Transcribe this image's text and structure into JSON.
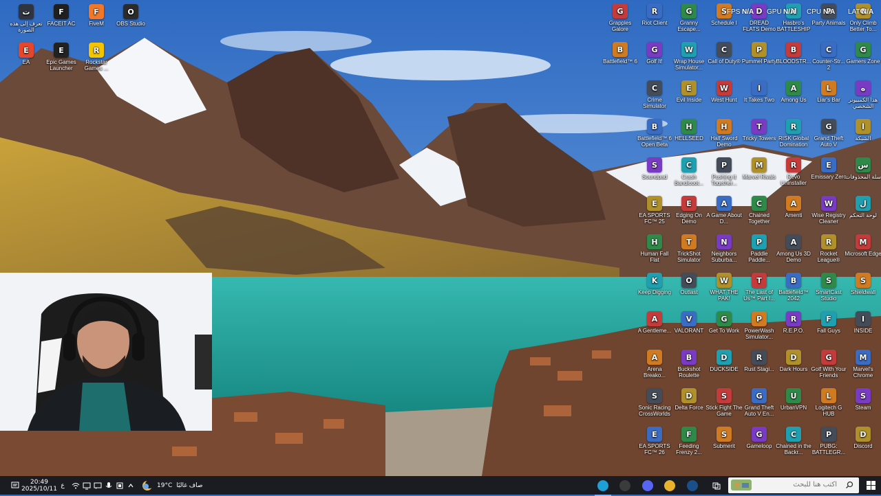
{
  "desktop": {
    "icons_left": [
      {
        "label": "تعرف إلى هذه الصورة",
        "icon": "info-icon",
        "color": "#2f3440"
      },
      {
        "label": "FACEIT AC",
        "icon": "faceit-icon",
        "color": "#1f1f1f"
      },
      {
        "label": "FiveM",
        "icon": "fivem-icon",
        "color": "#f0782a"
      },
      {
        "label": "OBS Studio",
        "icon": "obs-icon",
        "color": "#2b2b2b"
      },
      {
        "label": "EA",
        "icon": "ea-icon",
        "color": "#e4472c"
      },
      {
        "label": "Epic Games Launcher",
        "icon": "epic-games-icon",
        "color": "#222222"
      },
      {
        "label": "Rockstar Games ...",
        "icon": "rockstar-icon",
        "color": "#f5c400"
      }
    ],
    "grid": [
      [
        "Grapples Galore",
        "Riot Client",
        "Granny Escape...",
        "Schedule I",
        "DREAD FLATS Demo",
        "Hasbro's BATTLESHIP",
        "Party Animals",
        "Only Climb Better To..."
      ],
      [
        "Battlefield™ 6",
        "Golf It!",
        "Wrap House Simulator...",
        "Call of Duty®",
        "Pummel Party",
        "BLOODSTR...",
        "Counter-Str... 2",
        "Gamers Zone"
      ],
      [
        "Crime Simulator",
        "Evil Inside",
        "West Hunt",
        "It Takes Two",
        "Among Us",
        "Liar's Bar",
        "هذا الكمبيوتر الشخصي"
      ],
      [
        "Battlefield™ 6 Open Beta",
        "HELLSEED",
        "Half Sword Demo",
        "Tricky Towers",
        "RISK Global Domination",
        "Grand Theft Auto V",
        "الشبكة"
      ],
      [
        "Soundpad",
        "Crash Bandicoot...",
        "Pushing it Together...",
        "Marvel Rivals",
        "Revo Uninstaller",
        "Emissary Zero",
        "سلة المحذوفات"
      ],
      [
        "EA SPORTS FC™ 25",
        "Edging On Demo",
        "A Game About D...",
        "Chained Together",
        "Amenti",
        "Wise Registry Cleaner",
        "لوحة التحكم"
      ],
      [
        "Human Fall Flat",
        "TrickShot Simulator",
        "Neighbors Suburba...",
        "Paddle Paddle...",
        "Among Us 3D Demo",
        "Rocket League®",
        "Microsoft Edge"
      ],
      [
        "Keep Digging",
        "Outlast",
        "WHAT THE PAK!",
        "The Last of Us™ Part I...",
        "Battlefield™ 2042",
        "SmartCast Studio",
        "Shieldwall"
      ],
      [
        "A Gentleme...",
        "VALORANT",
        "Get To Work",
        "PowerWash Simulator...",
        "R.E.P.O.",
        "Fall Guys",
        "INSIDE"
      ],
      [
        "Arena Breako...",
        "Buckshot Roulette",
        "DUCKSIDE",
        "Rust Stagi...",
        "Dark Hours",
        "Golf With Your Friends",
        "Marvel's Chrome"
      ],
      [
        "Sonic Racing CrossWorlds",
        "Delta Force",
        "Stick Fight The Game",
        "Grand Theft Auto V En...",
        "UrbanVPN",
        "Logitech G HUB",
        "Steam"
      ],
      [
        "EA SPORTS FC™ 26",
        "Feeding Frenzy 2...",
        "Submerit",
        "Gameloop",
        "Chained in the Backr...",
        "PUBG: BATTLEGR...",
        "Discord"
      ]
    ],
    "grid_colors": [
      "#c43b3b",
      "#3b6cc4",
      "#2f8a4a",
      "#d07a22",
      "#7a3bc4",
      "#1f9fb0",
      "#444c5a",
      "#b0902a"
    ]
  },
  "overlay": {
    "fps_label": "FPS",
    "fps_value": "N/A",
    "gpu_label": "GPU",
    "gpu_value": "N/A",
    "cpu_label": "CPU",
    "cpu_value": "N/A",
    "lat_label": "LAT",
    "lat_value": "N/A"
  },
  "taskbar": {
    "time": "20:49",
    "date": "2025/10/11",
    "lang": "ع",
    "temperature": "19°C",
    "weather_text": "صاف غالبًا",
    "search_placeholder": "اكتب هنا للبحث",
    "pinned_apps": [
      {
        "name": "edge-icon",
        "color": "#1e9fd6"
      },
      {
        "name": "obs-icon",
        "color": "#3b3b3b"
      },
      {
        "name": "discord-icon",
        "color": "#5865f2"
      },
      {
        "name": "chrome-icon",
        "color": "#e8b32a"
      },
      {
        "name": "steam-icon",
        "color": "#1a4f8a"
      }
    ]
  }
}
